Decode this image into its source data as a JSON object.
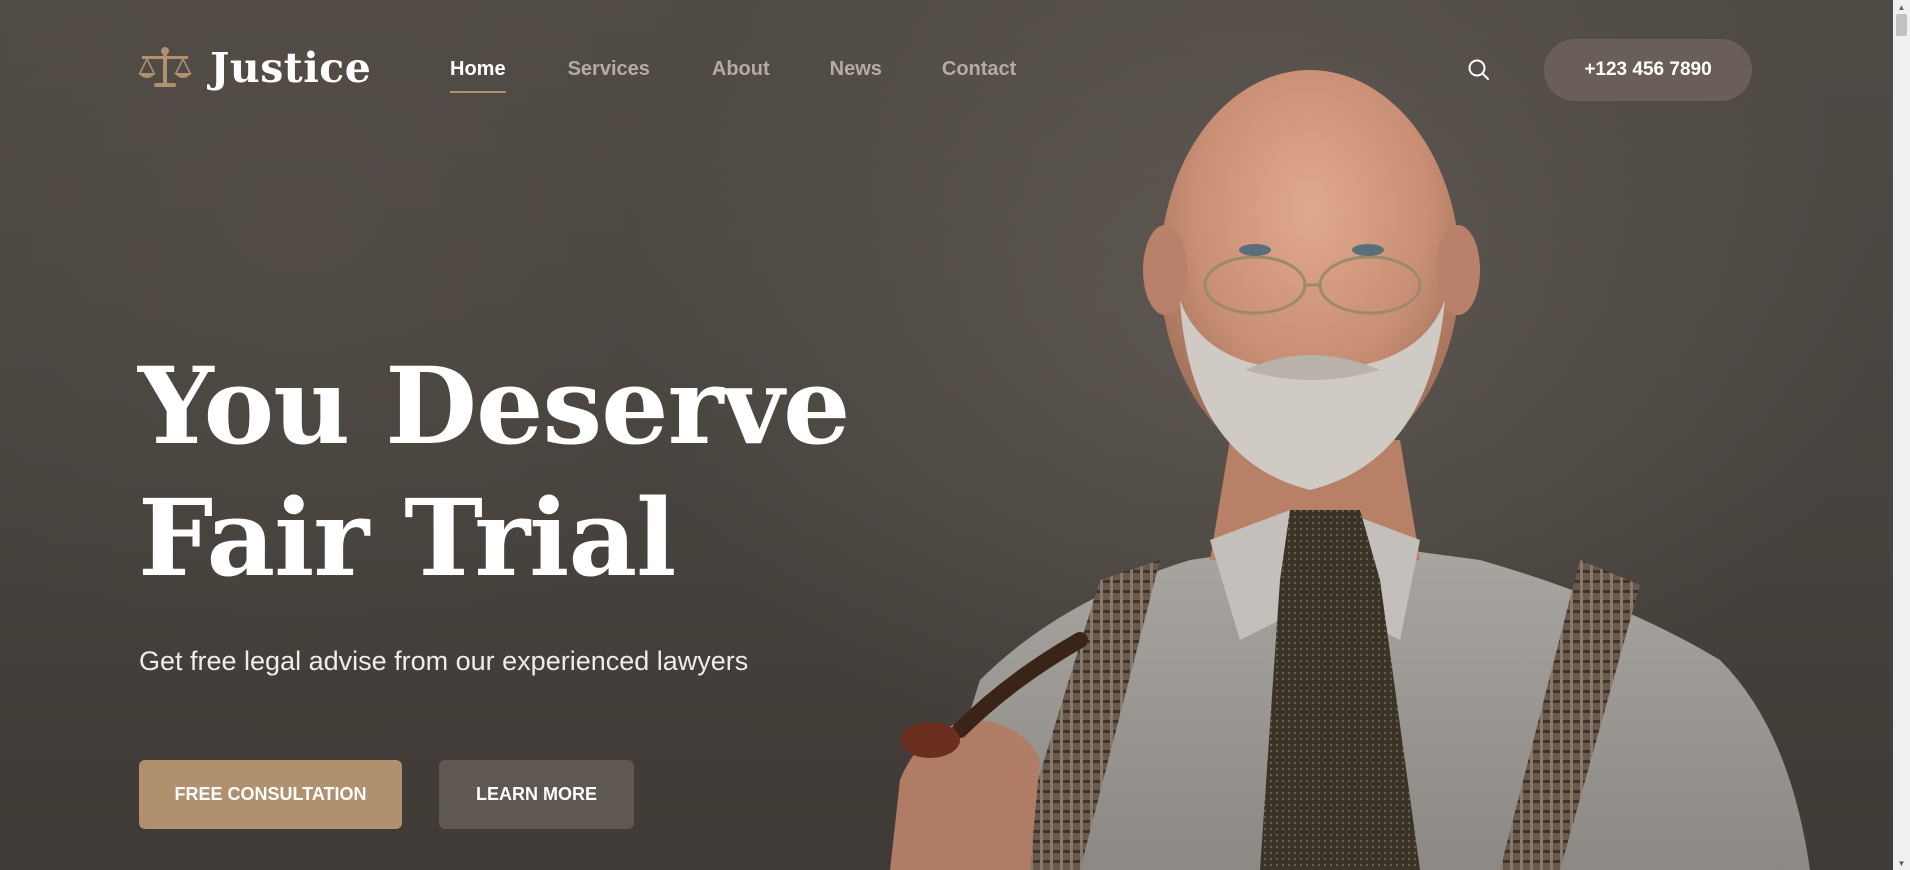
{
  "brand": {
    "name": "Justice",
    "icon": "scales-icon",
    "accent": "#b0906f"
  },
  "nav": {
    "items": [
      {
        "label": "Home",
        "active": true
      },
      {
        "label": "Services",
        "active": false
      },
      {
        "label": "About",
        "active": false
      },
      {
        "label": "News",
        "active": false
      },
      {
        "label": "Contact",
        "active": false
      }
    ]
  },
  "header": {
    "search_icon": "search-icon",
    "phone": "+123 456 7890"
  },
  "hero": {
    "headline_line1": "You Deserve",
    "headline_line2": "Fair Trial",
    "subtitle": "Get free legal advise from our experienced lawyers",
    "primary_cta": "FREE CONSULTATION",
    "secondary_cta": "LEARN MORE"
  },
  "colors": {
    "background": "#4f4943",
    "primary_button": "#b0906f",
    "secondary_button": "#5e5752",
    "phone_button": "#6a5f58"
  }
}
